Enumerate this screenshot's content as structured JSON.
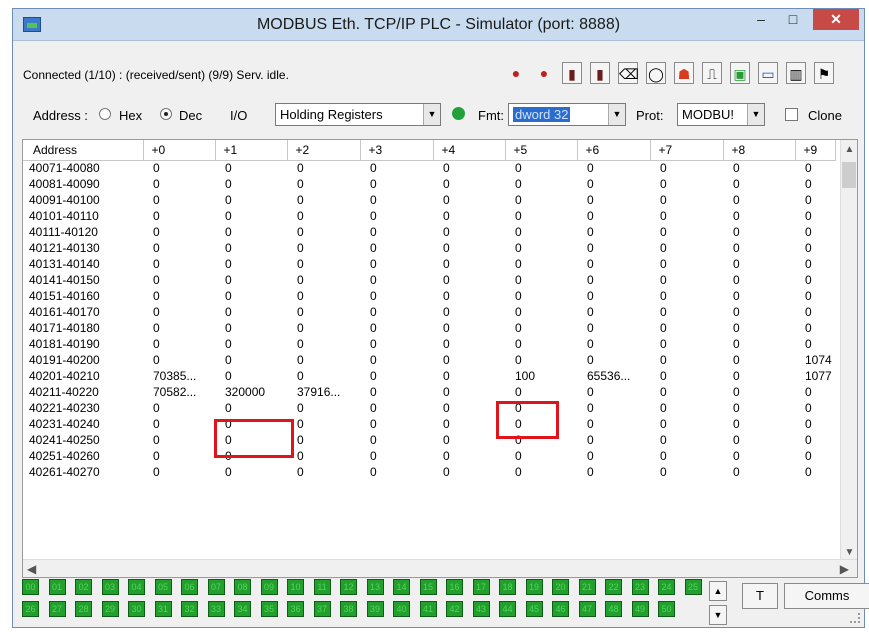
{
  "window": {
    "title": "MODBUS Eth. TCP/IP PLC - Simulator (port: 8888)",
    "min_symbol": "–",
    "max_symbol": "□",
    "close_symbol": "✕"
  },
  "status": {
    "text": "Connected (1/10) : (received/sent) (9/9) Serv. idle."
  },
  "toolbar": {
    "icons": [
      "red-dot-icon",
      "red-dot-icon",
      "plc-icon",
      "plc-icon",
      "eraser-icon",
      "comment-icon",
      "person-icon",
      "waveform-icon",
      "module-icon",
      "display-icon",
      "panel-icon",
      "flag-icon"
    ]
  },
  "settings": {
    "address_label": "Address :",
    "hex_label": "Hex",
    "dec_label": "Dec",
    "io_label": "I/O",
    "io_value": "Holding Registers",
    "fmt_label": "Fmt:",
    "fmt_value": "dword 32",
    "prot_label": "Prot:",
    "prot_value": "MODBU!",
    "clone_label": "Clone",
    "selected_radix": "Dec",
    "led_color": "#21a13a"
  },
  "grid": {
    "headers": [
      "Address",
      "+0",
      "+1",
      "+2",
      "+3",
      "+4",
      "+5",
      "+6",
      "+7",
      "+8",
      "+9"
    ],
    "rows": [
      {
        "addr": "40071-40080",
        "c": [
          "0",
          "0",
          "0",
          "0",
          "0",
          "0",
          "0",
          "0",
          "0",
          "0"
        ]
      },
      {
        "addr": "40081-40090",
        "c": [
          "0",
          "0",
          "0",
          "0",
          "0",
          "0",
          "0",
          "0",
          "0",
          "0"
        ]
      },
      {
        "addr": "40091-40100",
        "c": [
          "0",
          "0",
          "0",
          "0",
          "0",
          "0",
          "0",
          "0",
          "0",
          "0"
        ]
      },
      {
        "addr": "40101-40110",
        "c": [
          "0",
          "0",
          "0",
          "0",
          "0",
          "0",
          "0",
          "0",
          "0",
          "0"
        ]
      },
      {
        "addr": "40111-40120",
        "c": [
          "0",
          "0",
          "0",
          "0",
          "0",
          "0",
          "0",
          "0",
          "0",
          "0"
        ]
      },
      {
        "addr": "40121-40130",
        "c": [
          "0",
          "0",
          "0",
          "0",
          "0",
          "0",
          "0",
          "0",
          "0",
          "0"
        ]
      },
      {
        "addr": "40131-40140",
        "c": [
          "0",
          "0",
          "0",
          "0",
          "0",
          "0",
          "0",
          "0",
          "0",
          "0"
        ]
      },
      {
        "addr": "40141-40150",
        "c": [
          "0",
          "0",
          "0",
          "0",
          "0",
          "0",
          "0",
          "0",
          "0",
          "0"
        ]
      },
      {
        "addr": "40151-40160",
        "c": [
          "0",
          "0",
          "0",
          "0",
          "0",
          "0",
          "0",
          "0",
          "0",
          "0"
        ]
      },
      {
        "addr": "40161-40170",
        "c": [
          "0",
          "0",
          "0",
          "0",
          "0",
          "0",
          "0",
          "0",
          "0",
          "0"
        ]
      },
      {
        "addr": "40171-40180",
        "c": [
          "0",
          "0",
          "0",
          "0",
          "0",
          "0",
          "0",
          "0",
          "0",
          "0"
        ]
      },
      {
        "addr": "40181-40190",
        "c": [
          "0",
          "0",
          "0",
          "0",
          "0",
          "0",
          "0",
          "0",
          "0",
          "0"
        ]
      },
      {
        "addr": "40191-40200",
        "c": [
          "0",
          "0",
          "0",
          "0",
          "0",
          "0",
          "0",
          "0",
          "0",
          "1074"
        ]
      },
      {
        "addr": "40201-40210",
        "c": [
          "70385...",
          "0",
          "0",
          "0",
          "0",
          "100",
          "65536...",
          "0",
          "0",
          "1077"
        ]
      },
      {
        "addr": "40211-40220",
        "c": [
          "70582...",
          "320000",
          "37916...",
          "0",
          "0",
          "0",
          "0",
          "0",
          "0",
          "0"
        ]
      },
      {
        "addr": "40221-40230",
        "c": [
          "0",
          "0",
          "0",
          "0",
          "0",
          "0",
          "0",
          "0",
          "0",
          "0"
        ]
      },
      {
        "addr": "40231-40240",
        "c": [
          "0",
          "0",
          "0",
          "0",
          "0",
          "0",
          "0",
          "0",
          "0",
          "0"
        ]
      },
      {
        "addr": "40241-40250",
        "c": [
          "0",
          "0",
          "0",
          "0",
          "0",
          "0",
          "0",
          "0",
          "0",
          "0"
        ]
      },
      {
        "addr": "40251-40260",
        "c": [
          "0",
          "0",
          "0",
          "0",
          "0",
          "0",
          "0",
          "0",
          "0",
          "0"
        ]
      },
      {
        "addr": "40261-40270",
        "c": [
          "0",
          "0",
          "0",
          "0",
          "0",
          "0",
          "0",
          "0",
          "0",
          "0"
        ]
      }
    ]
  },
  "coils": {
    "row1": [
      "00",
      "01",
      "02",
      "03",
      "04",
      "05",
      "06",
      "07",
      "08",
      "09",
      "10",
      "11",
      "12",
      "13",
      "14",
      "15",
      "16",
      "17",
      "18",
      "19",
      "20",
      "21",
      "22",
      "23",
      "24",
      "25"
    ],
    "row2": [
      "26",
      "27",
      "28",
      "29",
      "30",
      "31",
      "32",
      "33",
      "34",
      "35",
      "36",
      "37",
      "38",
      "39",
      "40",
      "41",
      "42",
      "43",
      "44",
      "45",
      "46",
      "47",
      "48",
      "49",
      "50"
    ],
    "color": "#239f2e"
  },
  "buttons": {
    "t_label": "T",
    "comms_label": "Comms"
  },
  "colors": {
    "highlight": "#e0151b",
    "close": "#c74a46"
  }
}
